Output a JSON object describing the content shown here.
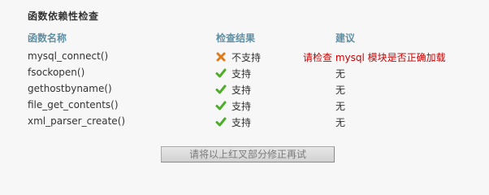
{
  "section": {
    "title": "函数依赖性检查"
  },
  "columns": {
    "name": "函数名称",
    "result": "检查结果",
    "advice": "建议"
  },
  "rows": [
    {
      "name": "mysql_connect()",
      "status": "fail",
      "icon": "cross-icon",
      "result": "不支持",
      "advice": "请检查 mysql 模块是否正确加载"
    },
    {
      "name": "fsockopen()",
      "status": "ok",
      "icon": "check-icon",
      "result": "支持",
      "advice": "无"
    },
    {
      "name": "gethostbyname()",
      "status": "ok",
      "icon": "check-icon",
      "result": "支持",
      "advice": "无"
    },
    {
      "name": "file_get_contents()",
      "status": "ok",
      "icon": "check-icon",
      "result": "支持",
      "advice": "无"
    },
    {
      "name": "xml_parser_create()",
      "status": "ok",
      "icon": "check-icon",
      "result": "支持",
      "advice": "无"
    }
  ],
  "button": {
    "label": "请将以上红叉部分修正再试"
  },
  "colors": {
    "header": "#5f8fa3",
    "warn": "#cc0000",
    "check": "#4caf27",
    "cross": "#e07a1a"
  }
}
